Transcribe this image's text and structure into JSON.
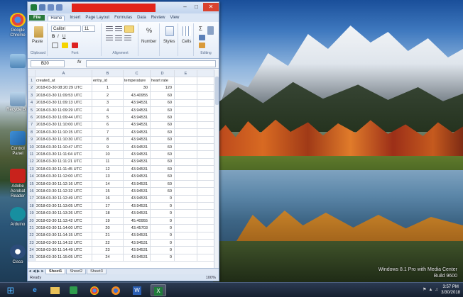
{
  "window": {
    "title": "",
    "tabs": [
      "File",
      "Home",
      "Insert",
      "Page Layout",
      "Formulas",
      "Data",
      "Review",
      "View"
    ],
    "ribbon": {
      "paste_label": "Paste",
      "font_name": "Calibri",
      "font_size": "11",
      "number_label": "Number",
      "styles_label": "Styles",
      "cells_label": "Cells",
      "groups": [
        "Clipboard",
        "Font",
        "Alignment",
        "Editing"
      ]
    },
    "name_box": "B20",
    "fx_label": "fx"
  },
  "sheet": {
    "columns": [
      "A",
      "B",
      "C",
      "D",
      "E"
    ],
    "header_row": [
      "created_at",
      "entry_id",
      "temperature",
      "heart rate"
    ],
    "rows": [
      [
        "2018-03-30 08:20:29 UTC",
        "1",
        "30",
        "120"
      ],
      [
        "2018-03-30 11:09:53 UTC",
        "2",
        "43.40955",
        "60"
      ],
      [
        "2018-03-30 11:09:13 UTC",
        "3",
        "43.94531",
        "60"
      ],
      [
        "2018-03-30 11:09:29 UTC",
        "4",
        "43.94531",
        "60"
      ],
      [
        "2018-03-30 11:09:44 UTC",
        "5",
        "43.94531",
        "60"
      ],
      [
        "2018-03-30 11:10:00 UTC",
        "6",
        "43.94531",
        "60"
      ],
      [
        "2018-03-30 11:10:15 UTC",
        "7",
        "43.94531",
        "60"
      ],
      [
        "2018-03-30 11:10:30 UTC",
        "8",
        "43.94531",
        "60"
      ],
      [
        "2018-03-30 11:10:47 UTC",
        "9",
        "43.94531",
        "60"
      ],
      [
        "2018-03-30 11:11:04 UTC",
        "10",
        "43.94531",
        "60"
      ],
      [
        "2018-03-30 11:11:21 UTC",
        "11",
        "43.94531",
        "60"
      ],
      [
        "2018-03-30 11:11:45 UTC",
        "12",
        "43.94531",
        "60"
      ],
      [
        "2018-03-30 11:12:00 UTC",
        "13",
        "43.94531",
        "60"
      ],
      [
        "2018-03-30 11:12:16 UTC",
        "14",
        "43.94531",
        "60"
      ],
      [
        "2018-03-30 11:12:32 UTC",
        "15",
        "43.94531",
        "60"
      ],
      [
        "2018-03-30 11:12:49 UTC",
        "16",
        "43.94531",
        "0"
      ],
      [
        "2018-03-30 11:13:05 UTC",
        "17",
        "43.94531",
        "0"
      ],
      [
        "2018-03-30 11:13:26 UTC",
        "18",
        "43.94531",
        "0"
      ],
      [
        "2018-03-30 11:13:42 UTC",
        "19",
        "45.40955",
        "0"
      ],
      [
        "2018-03-30 11:14:00 UTC",
        "20",
        "43.45703",
        "0"
      ],
      [
        "2018-03-30 11:14:15 UTC",
        "21",
        "43.94531",
        "0"
      ],
      [
        "2018-03-30 11:14:32 UTC",
        "22",
        "43.94531",
        "0"
      ],
      [
        "2018-03-30 11:14:49 UTC",
        "23",
        "43.94531",
        "0"
      ],
      [
        "2018-03-30 11:15:05 UTC",
        "24",
        "43.94531",
        "0"
      ]
    ],
    "sheet_tabs": [
      "Sheet1",
      "Sheet2",
      "Sheet3"
    ],
    "status": "Ready",
    "zoom": "100%"
  },
  "desktop": {
    "icons": [
      "Google Chrome",
      "Recycle Bin",
      "Control Panel",
      "Adobe Acrobat Reader",
      "Arduino",
      "Cisco"
    ],
    "watermark_line1": "Windows 8.1 Pro with Media Center",
    "watermark_line2": "Build 9600"
  },
  "taskbar": {
    "apps": [
      "start-icon",
      "ie-icon",
      "explorer-icon",
      "media-icon",
      "chrome-icon",
      "firefox-icon",
      "word-icon",
      "excel-icon"
    ],
    "time": "3:57 PM",
    "date": "3/30/2018"
  }
}
